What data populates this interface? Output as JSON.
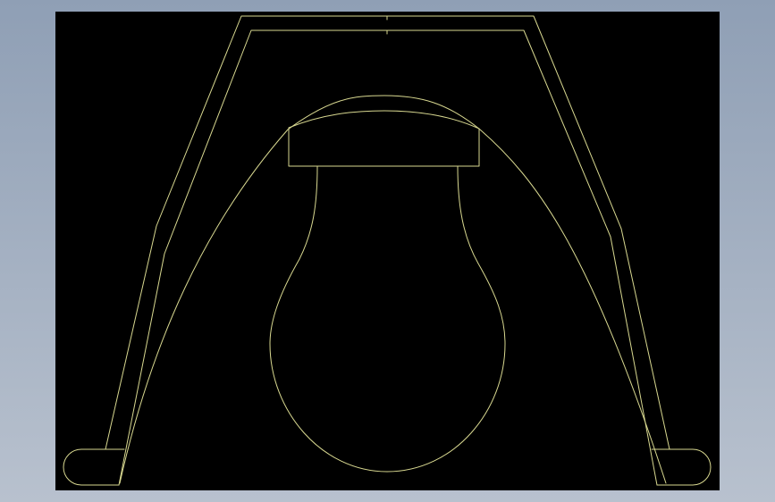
{
  "drawing": {
    "background_color": "#000000",
    "line_color": "#d8d890",
    "window_gradient_top": "#8f9fb5",
    "window_gradient_bottom": "#b8c1ce"
  }
}
